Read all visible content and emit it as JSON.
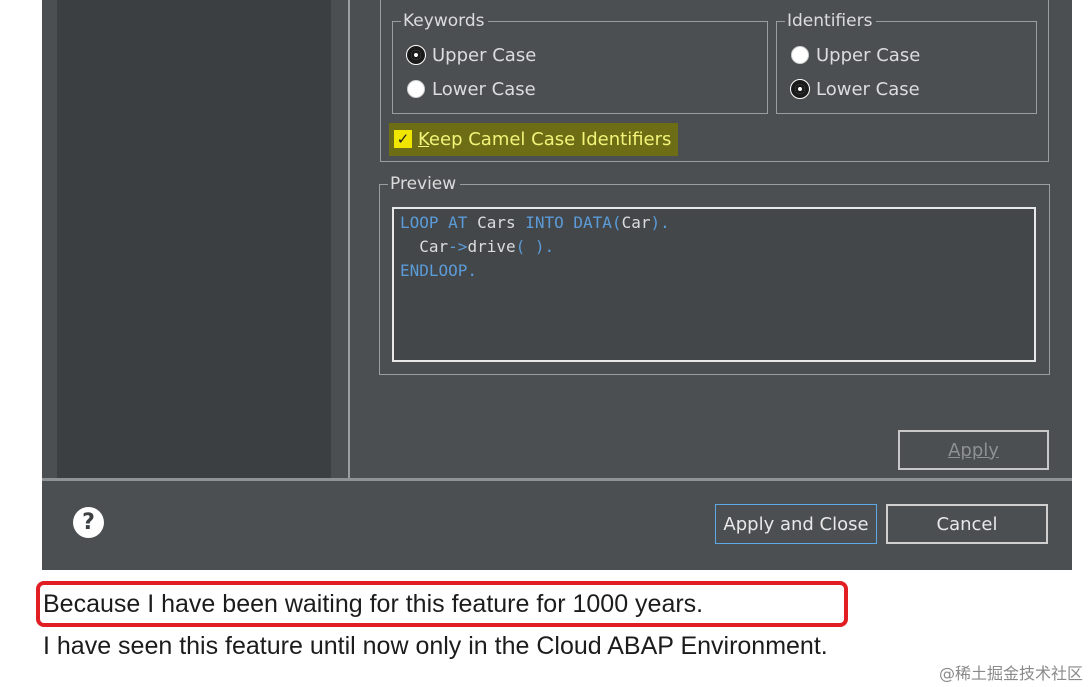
{
  "dialog": {
    "keywords_group": {
      "legend": "Keywords",
      "options": [
        "Upper Case",
        "Lower Case"
      ],
      "selected": "Upper Case"
    },
    "identifiers_group": {
      "legend": "Identifiers",
      "options": [
        "Upper Case",
        "Lower Case"
      ],
      "selected": "Lower Case"
    },
    "keep_camel": {
      "label_first": "K",
      "label_rest": "eep Camel Case Identifiers",
      "checked": true
    },
    "preview": {
      "legend": "Preview",
      "line1": [
        "LOOP AT ",
        "Cars",
        " INTO DATA(",
        "Car",
        ")."
      ],
      "line2": [
        "  ",
        "Car",
        "->",
        "drive",
        "( )."
      ],
      "line3": [
        "ENDLOOP."
      ]
    },
    "apply_label": "Apply",
    "apply_close_label": "Apply and Close",
    "cancel_label": "Cancel",
    "help_glyph": "?"
  },
  "notes": {
    "line1": "Because I have been waiting for this feature for 1000 years.",
    "line2": "I have seen this feature until now only in the Cloud ABAP Environment."
  },
  "watermark": "@稀土掘金技术社区",
  "colors": {
    "dialog_bg": "#4b4f52",
    "keyword": "#5b9bd8",
    "highlight": "#f1e600",
    "annotation_red": "#e21e25",
    "focus_blue": "#5fa8e8"
  }
}
